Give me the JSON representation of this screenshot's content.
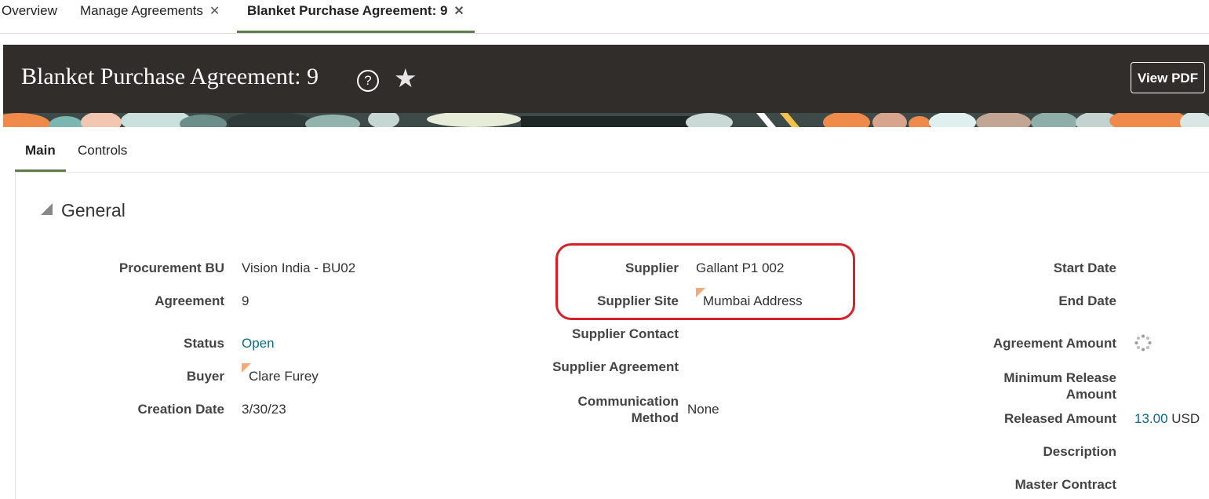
{
  "tabs": [
    {
      "label": "Overview"
    },
    {
      "label": "Manage Agreements",
      "close": "✕"
    },
    {
      "label": "Blanket Purchase Agreement: 9",
      "close": "✕"
    }
  ],
  "header": {
    "title": "Blanket Purchase Agreement: 9",
    "help_glyph": "?",
    "star_glyph": "★",
    "view_pdf": "View PDF"
  },
  "subtabs": [
    {
      "label": "Main"
    },
    {
      "label": "Controls"
    }
  ],
  "section": {
    "title": "General"
  },
  "fields": {
    "procurement_bu": {
      "label": "Procurement BU",
      "value": "Vision India - BU02"
    },
    "agreement": {
      "label": "Agreement",
      "value": "9"
    },
    "status": {
      "label": "Status",
      "value": "Open"
    },
    "buyer": {
      "label": "Buyer",
      "value": "Clare Furey"
    },
    "creation_date": {
      "label": "Creation Date",
      "value": "3/30/23"
    },
    "supplier": {
      "label": "Supplier",
      "value": "Gallant P1 002"
    },
    "supplier_site": {
      "label": "Supplier Site",
      "value": "Mumbai Address"
    },
    "supplier_contact": {
      "label": "Supplier Contact"
    },
    "supplier_agreement": {
      "label": "Supplier Agreement"
    },
    "communication_method": {
      "label_line1": "Communication",
      "label_line2": "Method",
      "value": "None"
    },
    "start_date": {
      "label": "Start Date"
    },
    "end_date": {
      "label": "End Date"
    },
    "agreement_amount": {
      "label": "Agreement Amount"
    },
    "minimum_release_amount": {
      "label_line1": "Minimum Release",
      "label_line2": "Amount"
    },
    "released_amount": {
      "label": "Released Amount",
      "value": "13.00",
      "currency": "USD"
    },
    "description": {
      "label": "Description"
    },
    "master_contract": {
      "label": "Master Contract"
    }
  },
  "colors": {
    "header_bg": "#312d2a",
    "tab_accent": "#5f7d4b",
    "link": "#0a6b8a",
    "highlight": "#d6202a",
    "flag": "#f4a978"
  }
}
